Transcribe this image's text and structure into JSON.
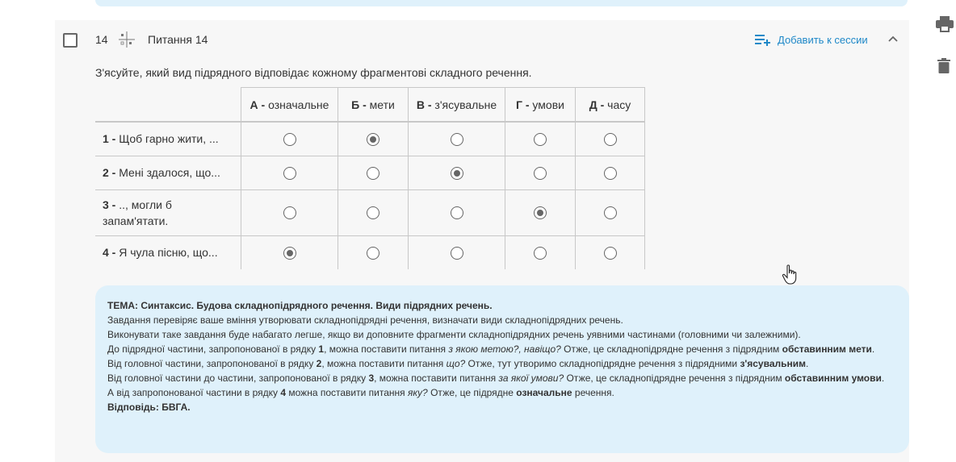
{
  "question": {
    "number": "14",
    "type_icon": "matching-grid-icon",
    "title": "Питання 14",
    "add_to_session": "Добавить к сессии",
    "prompt": "З'ясуйте, який вид підрядного відповідає кожному фрагментові складного речення."
  },
  "grid": {
    "columns": [
      {
        "letter": "А -",
        "text": " означальне"
      },
      {
        "letter": "Б -",
        "text": " мети"
      },
      {
        "letter": "В -",
        "text": " з'ясувальне"
      },
      {
        "letter": "Г -",
        "text": " умови"
      },
      {
        "letter": "Д -",
        "text": " часу"
      }
    ],
    "rows": [
      {
        "num": "1 -",
        "text": " Щоб гарно жити, ...",
        "selected_index": 1
      },
      {
        "num": "2 -",
        "text": " Мені здалося, що...",
        "selected_index": 2
      },
      {
        "num": "3 -",
        "text": " .., могли б запам'ятати.",
        "selected_index": 3
      },
      {
        "num": "4 -",
        "text": " Я чула пісню, що...",
        "selected_index": 0
      }
    ]
  },
  "explanation": {
    "topic": "ТЕМА: Синтаксис. Будова складнопідрядного речення. Види підрядних речень.",
    "line1": "Завдання перевіряє ваше вміння утворювати складнопідрядні речення, визначати види складнопідрядних речень.",
    "line2": "Виконувати таке завдання буде набагато легше, якщо ви доповните фрагменти складнопідрядних речень уявними частинами (головними чи залежними).",
    "l3a": "До підрядної частини, запропонованої в рядку ",
    "l3b": "1",
    "l3c": ", можна поставити питання ",
    "l3d": "з якою метою?, навіщо?",
    "l3e": " Отже, це складнопідрядне речення з підрядним ",
    "l3f": "обставинним мети",
    "l3g": ".",
    "l4a": "Від головної частини, запропонованої в рядку ",
    "l4b": "2",
    "l4c": ", можна поставити питання ",
    "l4d": "що?",
    "l4e": " Отже, тут утворимо складнопідрядне речення з підрядними ",
    "l4f": "з'ясувальним",
    "l4g": ".",
    "l5a": "Від головної частини до частини, запропонованої в рядку ",
    "l5b": "3",
    "l5c": ", можна поставити питання ",
    "l5d": "за якої умови?",
    "l5e": " Отже, це складнопідрядне речення з підрядним ",
    "l5f": "обставинним умови",
    "l5g": ".",
    "l6a": "А від запропонованої частини в рядку ",
    "l6b": "4",
    "l6c": " можна поставити питання ",
    "l6d": "яку?",
    "l6e": " Отже, це підрядне ",
    "l6f": "означальне",
    "l6g": " речення.",
    "answer": "Відповідь: БВГА."
  },
  "icons": {
    "print": "print-icon",
    "delete": "trash-icon",
    "collapse": "chevron-up-icon",
    "add": "playlist-add-icon",
    "cursor": "hand-cursor-icon"
  },
  "colors": {
    "accent": "#1e88c8",
    "explain_bg": "#dff1fb",
    "card_bg": "#f7f7f7"
  }
}
